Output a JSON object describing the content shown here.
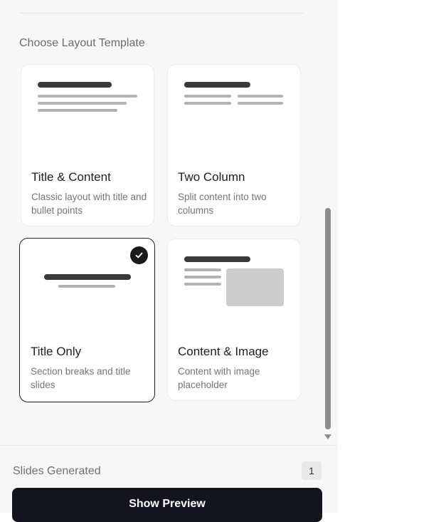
{
  "section": {
    "title": "Choose Layout Template"
  },
  "templates": [
    {
      "title": "Title & Content",
      "description": "Classic layout with title and bullet points",
      "selected": false
    },
    {
      "title": "Two Column",
      "description": "Split content into two columns",
      "selected": false
    },
    {
      "title": "Title Only",
      "description": "Section breaks and title slides",
      "selected": true
    },
    {
      "title": "Content & Image",
      "description": "Content with image placeholder",
      "selected": false
    }
  ],
  "footer": {
    "slides_label": "Slides Generated",
    "slides_count": "1",
    "preview_button": "Show Preview"
  },
  "colors": {
    "panel_bg": "#f7f7f7",
    "selected_border": "#222222",
    "button_bg": "#14141f"
  }
}
